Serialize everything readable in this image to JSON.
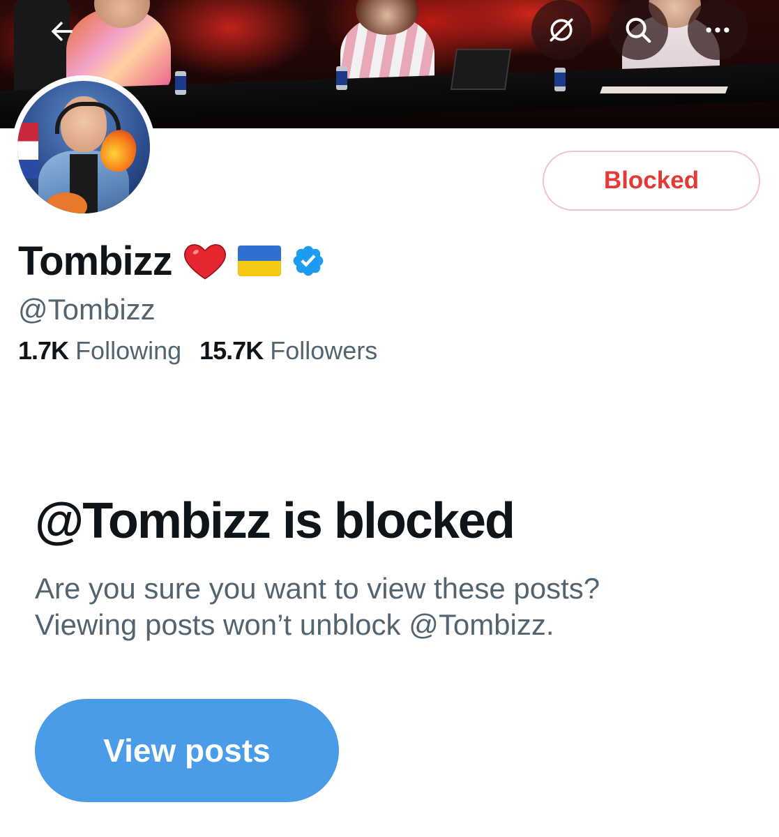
{
  "header": {
    "back_icon": "arrow-left-icon",
    "hide_icon": "eye-slash-icon",
    "search_icon": "search-icon",
    "more_icon": "more-horizontal-icon"
  },
  "profile": {
    "display_name": "Tombizz",
    "name_emojis": [
      "heart-emoji",
      "ukraine-flag-emoji"
    ],
    "verified": true,
    "handle": "@Tombizz",
    "following_count": "1.7K",
    "following_label": "Following",
    "followers_count": "15.7K",
    "followers_label": "Followers",
    "block_button_label": "Blocked"
  },
  "blocked_notice": {
    "title": "@Tombizz is blocked",
    "line1": "Are you sure you want to view these posts?",
    "line2": "Viewing posts won’t unblock @Tombizz.",
    "view_button_label": "View posts"
  },
  "colors": {
    "accent_blue": "#4a9be8",
    "blocked_red": "#e53935",
    "blocked_border": "#f5c2c7",
    "verified_blue": "#1d9bf0",
    "text_primary": "#0f1419",
    "text_secondary": "#536471"
  }
}
